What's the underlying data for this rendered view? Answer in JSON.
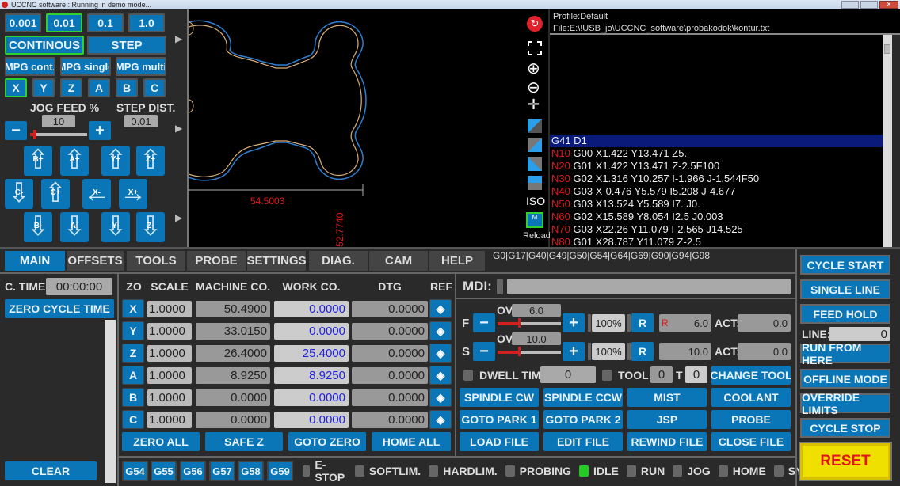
{
  "window": {
    "title": "UCCNC software : Running in demo mode..."
  },
  "jog": {
    "step_sizes": [
      "0.001",
      "0.01",
      "0.1",
      "1.0"
    ],
    "selected_step": "0.01",
    "continuous": "CONTINOUS",
    "step": "STEP",
    "mpg": [
      "MPG cont.",
      "MPG single",
      "MPG multi"
    ],
    "axes": [
      "X",
      "Y",
      "Z",
      "A",
      "B",
      "C"
    ],
    "selected_axis": "X",
    "jog_feed_label": "JOG FEED %",
    "jog_feed_value": "10",
    "jog_feed_percent": 10,
    "step_dist_label": "STEP DIST.",
    "step_dist_value": "0.01",
    "minus": "−",
    "plus": "+",
    "buttons_row1": [
      "B+",
      "A+",
      "Y+",
      "Z+"
    ],
    "buttons_row2": [
      "C-",
      "C+",
      "X-",
      "X+"
    ],
    "buttons_row3": [
      "B-",
      "A-",
      "Y-",
      "Z-"
    ]
  },
  "view": {
    "dim_x": "54.5003",
    "dim_y": "52.7740",
    "path_color": "#d9b07a",
    "comp_color": "#2f7fd0",
    "tools": [
      "logo-icon",
      "fit-icon",
      "zoom-in-icon",
      "zoom-out-icon",
      "center-icon",
      "view-top-icon",
      "view-front-icon",
      "view-side-icon",
      "view-iso-icon"
    ],
    "iso_label": "ISO",
    "reload_label": "Reload"
  },
  "file": {
    "profile": "Profile:Default",
    "file": "File:E:\\!USB_jo\\UCCNC_software\\probakódok\\kontur.txt"
  },
  "gcode": [
    {
      "n": "",
      "code": "G41 D1",
      "active": true
    },
    {
      "n": "N10",
      "code": " G00 X1.422 Y13.471 Z5."
    },
    {
      "n": "N20",
      "code": " G01 X1.422 Y13.471 Z-2.5F100"
    },
    {
      "n": "N30",
      "code": " G02 X1.316 Y10.257 I-1.966 J-1.544F50"
    },
    {
      "n": "N40",
      "code": " G03 X-0.476 Y5.579 I5.208 J-4.677"
    },
    {
      "n": "N50",
      "code": " G03 X13.524 Y5.589 I7. J0."
    },
    {
      "n": "N60",
      "code": " G02 X15.589 Y8.054 I2.5 J0.003"
    },
    {
      "n": "N70",
      "code": " G03 X22.26 Y11.079 I-2.565 J14.525"
    },
    {
      "n": "N80",
      "code": " G01 X28.787 Y11.079 Z-2.5"
    }
  ],
  "tabs": [
    "MAIN",
    "OFFSETS",
    "TOOLS",
    "PROBE",
    "SETTINGS",
    "DIAG.",
    "CAM",
    "HELP"
  ],
  "active_tab": "MAIN",
  "modal": "G0|G17|G40|G49|G50|G54|G64|G69|G90|G94|G98",
  "cycle": {
    "label": "C. TIME:",
    "value": "00:00:00",
    "zero": "ZERO CYCLE TIME",
    "clear": "CLEAR"
  },
  "dro": {
    "headers": [
      "ZO",
      "SCALE",
      "MACHINE CO.",
      "WORK CO.",
      "DTG",
      "REF"
    ],
    "rows": [
      {
        "axis": "X",
        "scale": "1.0000",
        "machine": "50.4900",
        "work": "0.0000",
        "dtg": "0.0000"
      },
      {
        "axis": "Y",
        "scale": "1.0000",
        "machine": "33.0150",
        "work": "0.0000",
        "dtg": "0.0000"
      },
      {
        "axis": "Z",
        "scale": "1.0000",
        "machine": "26.4000",
        "work": "25.4000",
        "dtg": "0.0000"
      },
      {
        "axis": "A",
        "scale": "1.0000",
        "machine": "8.9250",
        "work": "8.9250",
        "dtg": "0.0000"
      },
      {
        "axis": "B",
        "scale": "1.0000",
        "machine": "0.0000",
        "work": "0.0000",
        "dtg": "0.0000"
      },
      {
        "axis": "C",
        "scale": "1.0000",
        "machine": "0.0000",
        "work": "0.0000",
        "dtg": "0.0000"
      }
    ],
    "buttons": [
      "ZERO ALL",
      "SAFE Z",
      "GOTO ZERO",
      "HOME ALL"
    ]
  },
  "work_offsets": [
    "G54",
    "G55",
    "G56",
    "G57",
    "G58",
    "G59"
  ],
  "active_offset": "G54",
  "mdi": {
    "label": "MDI:",
    "value": ""
  },
  "feed": {
    "label": "F",
    "ov_label": "OV:",
    "ov": "6.0",
    "percent": "100%",
    "reset": "R",
    "r_mark": "R",
    "set": "6.0",
    "act_label": "ACT:",
    "act": "0.0"
  },
  "spindle": {
    "label": "S",
    "ov_label": "OV:",
    "ov": "10.0",
    "percent": "100%",
    "reset": "R",
    "set": "10.0",
    "act_label": "ACT:",
    "act": "0.0"
  },
  "dwell": {
    "label": "DWELL TIME:",
    "value": "0",
    "tool_label": "TOOL:",
    "tool": "0",
    "t_label": "T",
    "t": "0",
    "change": "CHANGE TOOL"
  },
  "actions": [
    "SPINDLE CW",
    "SPINDLE CCW",
    "MIST",
    "COOLANT",
    "GOTO PARK 1",
    "GOTO PARK 2",
    "JSP",
    "PROBE",
    "LOAD FILE",
    "EDIT FILE",
    "REWIND FILE",
    "CLOSE FILE"
  ],
  "status": [
    {
      "label": "E-STOP",
      "on": false
    },
    {
      "label": "SOFTLIM.",
      "on": false
    },
    {
      "label": "HARDLIM.",
      "on": false
    },
    {
      "label": "PROBING",
      "on": false
    },
    {
      "label": "IDLE",
      "on": true
    },
    {
      "label": "RUN",
      "on": false
    },
    {
      "label": "JOG",
      "on": false
    },
    {
      "label": "HOME",
      "on": false
    },
    {
      "label": "SYNC.",
      "on": false
    }
  ],
  "side": {
    "cycle_start": "CYCLE START",
    "single_line": "SINGLE LINE",
    "feed_hold": "FEED HOLD",
    "line_label": "LINE:",
    "line": "0",
    "run_from_here": "RUN FROM HERE",
    "offline": "OFFLINE MODE",
    "override": "OVERRIDE LIMITS",
    "cycle_stop": "CYCLE STOP",
    "reset": "RESET"
  },
  "colors": {
    "accent": "#0a76b8",
    "active": "#2fd02f",
    "reset_bg": "#f0e000",
    "reset_text": "#e01818",
    "line_no": "#e01818",
    "work_text": "#2020e0"
  }
}
